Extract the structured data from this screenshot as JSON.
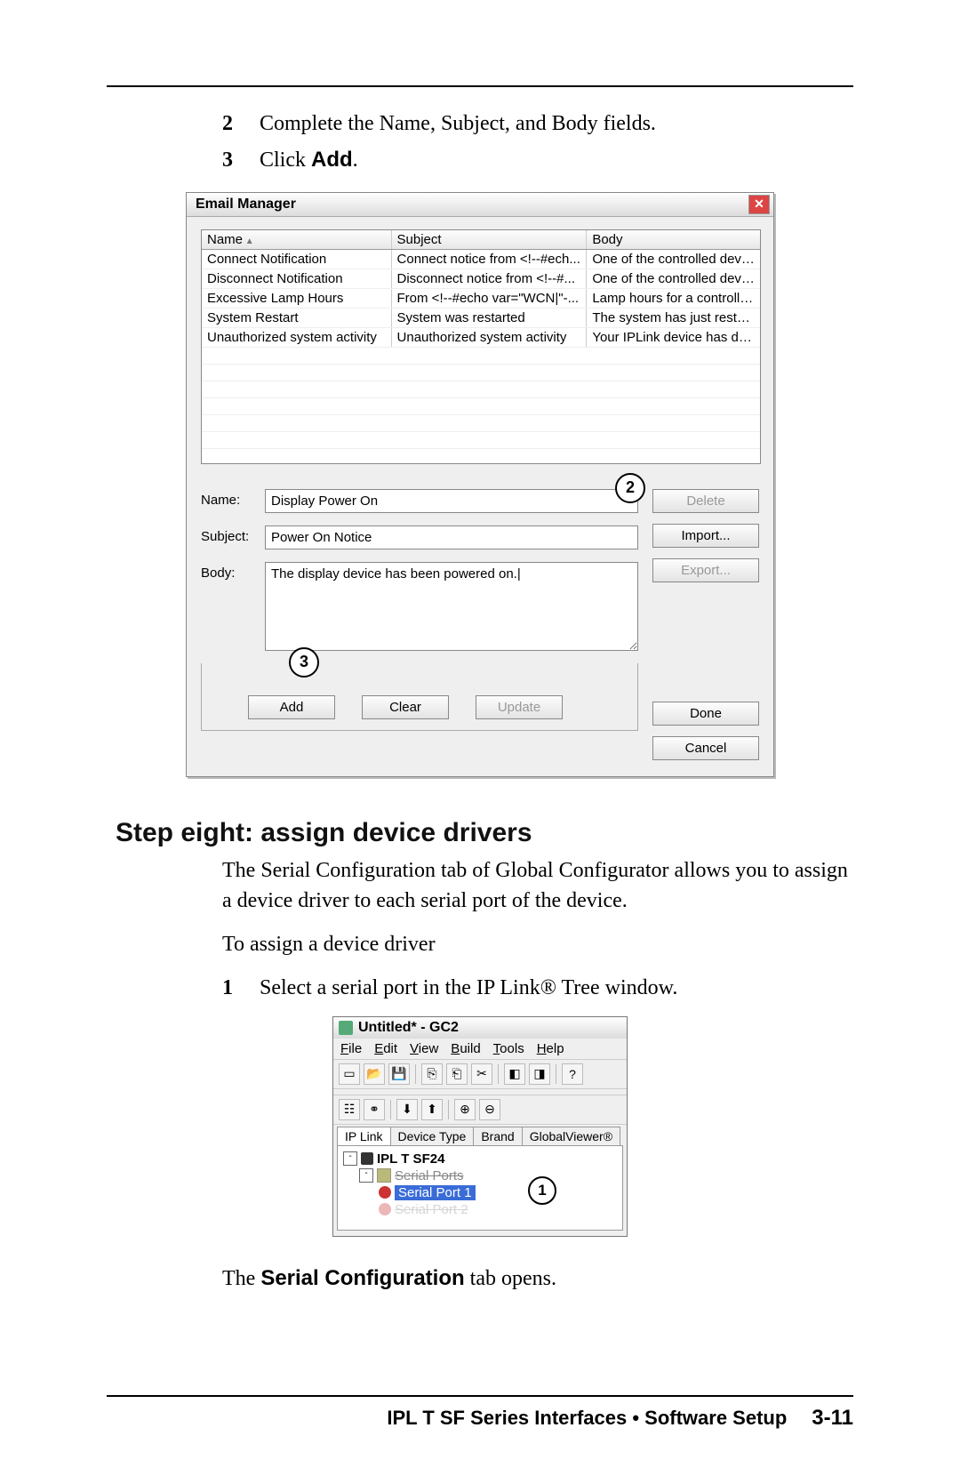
{
  "steps_top": [
    {
      "num": "2",
      "text": "Complete the Name, Subject, and Body fields."
    },
    {
      "num": "3",
      "text_prefix": "Click ",
      "bold": "Add",
      "suffix": "."
    }
  ],
  "email_manager": {
    "title": "Email Manager",
    "columns": {
      "name": "Name",
      "subject": "Subject",
      "body": "Body"
    },
    "rows": [
      {
        "name": "Connect Notification",
        "subject": "Connect notice from <!--#ech...",
        "body": "One of the controlled devices..."
      },
      {
        "name": "Disconnect Notification",
        "subject": "Disconnect notice from <!--#...",
        "body": "One of the controlled devices..."
      },
      {
        "name": "Excessive Lamp Hours",
        "subject": "From <!--#echo var=\"WCN|\"-...",
        "body": "Lamp hours for a controlled p..."
      },
      {
        "name": "System Restart",
        "subject": "System was restarted",
        "body": "The system has just restarted."
      },
      {
        "name": "Unauthorized system activity",
        "subject": "Unauthorized system activity",
        "body": "Your IPLink device has dete..."
      }
    ],
    "callouts": {
      "two": "2",
      "three": "3"
    },
    "form": {
      "name_label": "Name:",
      "subject_label": "Subject:",
      "body_label": "Body:",
      "name_value": "Display Power On",
      "subject_value": "Power On Notice",
      "body_value": "The display device has been powered on.|"
    },
    "side_buttons": {
      "delete": "Delete",
      "import": "Import...",
      "export": "Export...",
      "done": "Done",
      "cancel": "Cancel"
    },
    "bottom_buttons": {
      "add": "Add",
      "clear": "Clear",
      "update": "Update"
    }
  },
  "heading": "Step eight: assign device drivers",
  "para1": "The Serial Configuration tab of Global Configurator allows you to assign a device driver to each serial port of the device.",
  "para2": "To assign a device driver",
  "step1": {
    "num": "1",
    "text": "Select a serial port in the IP Link® Tree window."
  },
  "gc2": {
    "title": "Untitled* - GC2",
    "menus": [
      "File",
      "Edit",
      "View",
      "Build",
      "Tools",
      "Help"
    ],
    "tabs": [
      "IP Link",
      "Device Type",
      "Brand",
      "GlobalViewer®"
    ],
    "tree": {
      "root": "IPL T SF24",
      "group": "Serial Ports",
      "item1": "Serial Port 1",
      "item2": "Serial Port 2"
    },
    "callout": "1"
  },
  "closing": {
    "pre": "The ",
    "bold": "Serial Configuration",
    "post": " tab opens."
  },
  "footer": {
    "title": "IPL T SF Series Interfaces • Software Setup",
    "page": "3-11"
  }
}
